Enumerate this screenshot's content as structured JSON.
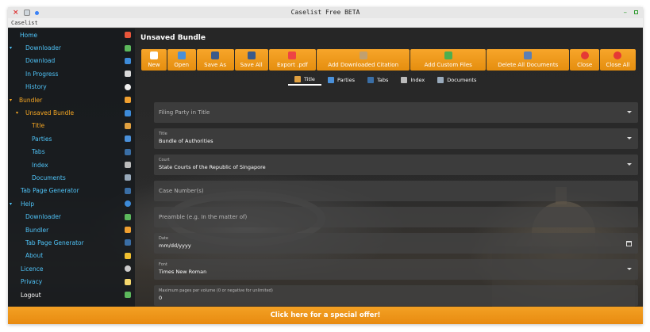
{
  "window": {
    "title": "Caselist Free BETA",
    "menu": "Caselist"
  },
  "colors": {
    "accent": "#f5a623",
    "link": "#4fc3f7",
    "toolbar": "#f29e22",
    "offer": "#ef9818"
  },
  "sidebar": {
    "items": [
      {
        "label": "Home",
        "icon": "home-icon",
        "color": "#e8553a"
      },
      {
        "label": "Downloader",
        "icon": "download-icon",
        "color": "#5cb85c"
      },
      {
        "label": "Download",
        "icon": "download-arrow-icon",
        "color": "#3d8bd9"
      },
      {
        "label": "In Progress",
        "icon": "hourglass-icon",
        "color": "#d9d9d9"
      },
      {
        "label": "History",
        "icon": "clock-icon",
        "color": "#f0f0f0"
      },
      {
        "label": "Bundler",
        "icon": "bundle-icon",
        "color": "#f0a030"
      },
      {
        "label": "Unsaved Bundle",
        "icon": "bundle-blue-icon",
        "color": "#3d8bd9"
      },
      {
        "label": "Title",
        "icon": "title-icon",
        "color": "#e0a040"
      },
      {
        "label": "Parties",
        "icon": "parties-icon",
        "color": "#4a90d9"
      },
      {
        "label": "Tabs",
        "icon": "tabs-icon",
        "color": "#3a6ea5"
      },
      {
        "label": "Index",
        "icon": "index-icon",
        "color": "#bbbbbb"
      },
      {
        "label": "Documents",
        "icon": "documents-icon",
        "color": "#9ab"
      },
      {
        "label": "Tab Page Generator",
        "icon": "tab-generator-icon",
        "color": "#3a6ea5"
      },
      {
        "label": "Help",
        "icon": "help-icon",
        "color": "#3d8bd9"
      },
      {
        "label": "Downloader",
        "icon": "download-icon",
        "color": "#5cb85c"
      },
      {
        "label": "Bundler",
        "icon": "bundle-icon",
        "color": "#f0a030"
      },
      {
        "label": "Tab Page Generator",
        "icon": "tab-generator-icon",
        "color": "#3a6ea5"
      },
      {
        "label": "About",
        "icon": "warning-icon",
        "color": "#f0c030"
      },
      {
        "label": "Licence",
        "icon": "licence-icon",
        "color": "#cccccc"
      },
      {
        "label": "Privacy",
        "icon": "privacy-icon",
        "color": "#f5d76e"
      },
      {
        "label": "Logout",
        "icon": "logout-icon",
        "color": "#5cb85c"
      }
    ]
  },
  "main": {
    "title": "Unsaved Bundle",
    "toolbar": [
      {
        "label": "New",
        "icon": "new-file-icon"
      },
      {
        "label": "Open",
        "icon": "open-folder-icon"
      },
      {
        "label": "Save As",
        "icon": "save-as-icon"
      },
      {
        "label": "Save All",
        "icon": "save-all-icon"
      },
      {
        "label": "Export .pdf",
        "icon": "pdf-icon"
      },
      {
        "label": "Add Downloaded Citation",
        "icon": "citation-icon"
      },
      {
        "label": "Add Custom Files",
        "icon": "add-files-icon"
      },
      {
        "label": "Delete All Documents",
        "icon": "delete-docs-icon"
      },
      {
        "label": "Close",
        "icon": "close-circle-icon"
      },
      {
        "label": "Close All",
        "icon": "close-all-icon"
      }
    ],
    "tabs": [
      {
        "label": "Title",
        "icon": "title-icon"
      },
      {
        "label": "Parties",
        "icon": "parties-icon"
      },
      {
        "label": "Tabs",
        "icon": "tabs-icon"
      },
      {
        "label": "Index",
        "icon": "index-icon"
      },
      {
        "label": "Documents",
        "icon": "documents-icon"
      }
    ],
    "fields": {
      "filing_party": {
        "placeholder": "Filing Party in Title"
      },
      "title": {
        "label": "Title",
        "value": "Bundle of Authorities"
      },
      "court": {
        "label": "Court",
        "value": "State Courts of the Republic of Singapore"
      },
      "case_numbers": {
        "placeholder": "Case Number(s)"
      },
      "preamble": {
        "placeholder": "Preamble (e.g. In the matter of)"
      },
      "date": {
        "label": "Date",
        "value": "mm/dd/yyyy"
      },
      "font": {
        "label": "Font",
        "value": "Times New Roman"
      },
      "max_pages": {
        "label": "Maximum pages per volume (0 or negative for unlimited)",
        "value": "0"
      }
    }
  },
  "offer": {
    "label": "Click here for a special offer!"
  }
}
